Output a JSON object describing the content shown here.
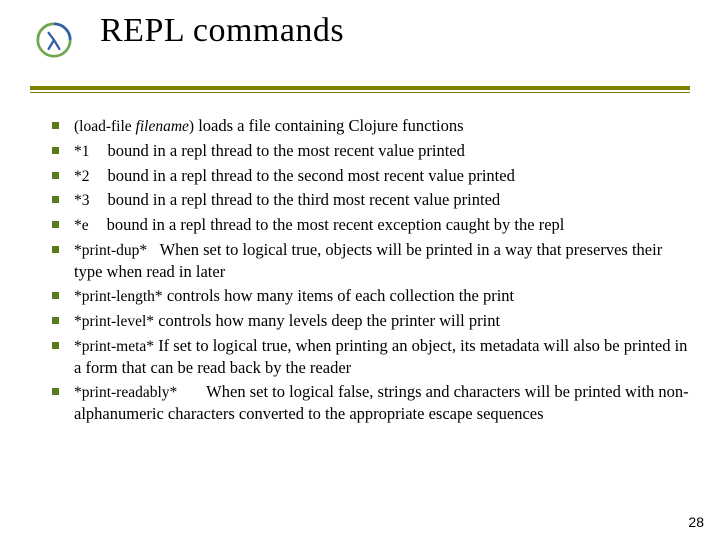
{
  "header": {
    "title": "REPL commands"
  },
  "page_number": "28",
  "items": [
    {
      "code": "(load-file",
      "arg": " filename",
      "code_close": ")",
      "desc": " loads a file containing Clojure functions"
    },
    {
      "code": "*1",
      "desc": "bound in a repl thread to the most recent value printed"
    },
    {
      "code": "*2",
      "desc": "bound in a repl thread to the second most recent value printed"
    },
    {
      "code": "*3",
      "desc": "bound in a repl thread to the third most recent value printed"
    },
    {
      "code": "*e",
      "desc": "bound in a repl thread to the most recent exception caught by the repl"
    },
    {
      "code": "*print-dup*",
      "desc": "When set to logical true, objects will be printed in a way that preserves their type when read in later"
    },
    {
      "code": "*print-length*",
      "desc": "controls how many items of each collection the print"
    },
    {
      "code": "*print-level*",
      "desc": "controls how many levels deep the printer will print"
    },
    {
      "code": "*print-meta*",
      "desc": "If set to logical true, when printing an object, its metadata will also be printed in a form that can be read back by the reader"
    },
    {
      "code": "*print-readably*",
      "desc": "When set to logical false, strings and characters will be printed with non-alphanumeric characters converted to the appropriate escape sequences"
    }
  ]
}
